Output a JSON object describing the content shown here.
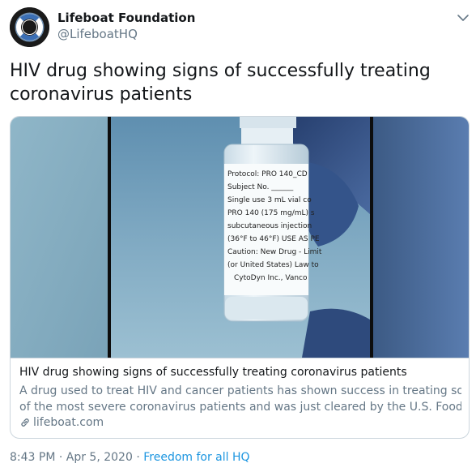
{
  "author": {
    "name": "Lifeboat Foundation",
    "handle": "@LifeboatHQ",
    "avatar_icon": "life-ring-icon"
  },
  "tweet": {
    "text_line1": "HIV drug showing signs of successfully treating",
    "text_line2": "coronavirus patients"
  },
  "card": {
    "title": "HIV drug showing signs of successfully treating coronavirus patients",
    "description_line1": "A drug used to treat HIV and cancer patients has shown success in treating some",
    "description_line2": "of the most severe coronavirus patients and was just cleared by the U.S. Food an...",
    "domain": "lifeboat.com",
    "link_icon": "link-icon",
    "vial_label": {
      "line1": "Protocol: PRO 140_CD",
      "line2": "Subject No. ______",
      "line3": "Single use 3 mL vial co",
      "line4": "PRO 140 (175 mg/mL) s",
      "line5": "subcutaneous injection",
      "line6": "(36°F to 46°F) USE AS PE",
      "line7": "Caution: New Drug - Limit",
      "line8": "(or United States) Law to",
      "line9": "CytoDyn Inc., Vanco"
    }
  },
  "footer": {
    "time": "8:43 PM · Apr 5, 2020",
    "separator": " · ",
    "app": "Freedom for all HQ"
  },
  "colors": {
    "text": "#14171a",
    "secondary": "#657786",
    "link": "#1b95e0",
    "border": "#ccd6dd"
  }
}
